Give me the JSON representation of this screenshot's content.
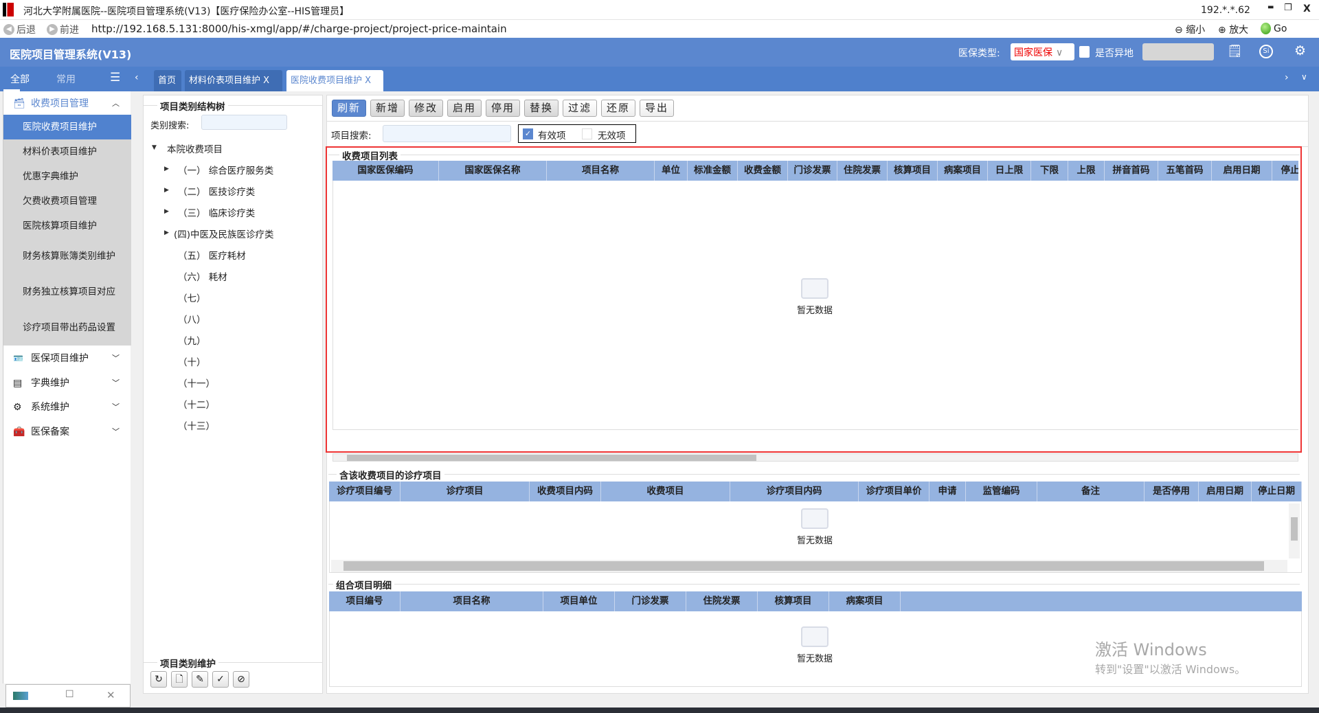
{
  "window": {
    "title": "河北大学附属医院--医院项目管理系统(V13)【医疗保险办公室--HIS管理员】",
    "ip": "192.*.*.62",
    "minimize": "▬",
    "restore": "❐",
    "close": "X"
  },
  "browser": {
    "back": "后退",
    "forward": "前进",
    "url": "http://192.168.5.131:8000/his-xmgl/app/#/charge-project/project-price-maintain",
    "zoom_out": "缩小",
    "zoom_in": "放大",
    "go": "Go"
  },
  "header": {
    "app_title": "医院项目管理系统(V13)",
    "insurance_type_label": "医保类型:",
    "insurance_type_value": "国家医保",
    "remote_label": "是否异地",
    "remote_checked": false,
    "accent": "#5b87cf"
  },
  "sidebar": {
    "tabs": [
      "全部",
      "常用"
    ],
    "active_tab": "全部",
    "groups": [
      {
        "label": "收费项目管理",
        "icon": "cash-register-icon",
        "expanded": true,
        "items": [
          "医院收费项目维护",
          "材料价表项目维护",
          "优惠字典维护",
          "欠费收费项目管理",
          "医院核算项目维护",
          "财务核算账簿类别维护",
          "财务独立核算项目对应",
          "诊疗项目带出药品设置"
        ],
        "active": "医院收费项目维护"
      },
      {
        "label": "医保项目维护",
        "icon": "id-card-icon"
      },
      {
        "label": "字典维护",
        "icon": "list-icon"
      },
      {
        "label": "系统维护",
        "icon": "gear-icon"
      },
      {
        "label": "医保备案",
        "icon": "medical-kit-icon"
      }
    ]
  },
  "tabs": [
    {
      "label": "首页",
      "closable": false
    },
    {
      "label": "材料价表项目维护",
      "closable": true
    },
    {
      "label": "医院收费项目维护",
      "closable": true,
      "active": true
    }
  ],
  "tree": {
    "title": "项目类别结构树",
    "search_label": "类别搜索:",
    "search_value": "",
    "root": "本院收费项目",
    "nodes": [
      {
        "label": "（一） 综合医疗服务类",
        "has_children": true
      },
      {
        "label": "（二） 医技诊疗类",
        "has_children": true
      },
      {
        "label": "（三） 临床诊疗类",
        "has_children": true
      },
      {
        "label": "(四)中医及民族医诊疗类",
        "has_children": true
      },
      {
        "label": "（五） 医疗耗材"
      },
      {
        "label": "（六） 耗材"
      },
      {
        "label": "（七）"
      },
      {
        "label": "（八）"
      },
      {
        "label": "（九）"
      },
      {
        "label": "（十）"
      },
      {
        "label": "（十一）"
      },
      {
        "label": "（十二）"
      },
      {
        "label": "（十三）"
      }
    ],
    "maintain_title": "项目类别维护",
    "maintain_buttons": [
      "refresh-icon",
      "add-file-icon",
      "edit-icon",
      "check-circle-icon",
      "forbid-icon"
    ]
  },
  "toolbar": {
    "buttons": [
      "刷新",
      "新增",
      "修改",
      "启用",
      "停用",
      "替换",
      "过滤",
      "还原",
      "导出"
    ],
    "search_label": "项目搜索:",
    "search_value": "",
    "valid_label": "有效项",
    "valid_checked": true,
    "invalid_label": "无效项",
    "invalid_checked": false
  },
  "charge_list": {
    "title": "收费项目列表",
    "columns": [
      "国家医保编码",
      "国家医保名称",
      "项目名称",
      "单位",
      "标准金额",
      "收费金额",
      "门诊发票",
      "住院发票",
      "核算项目",
      "病案项目",
      "日上限",
      "下限",
      "上限",
      "拼音首码",
      "五笔首码",
      "启用日期",
      "停止日期"
    ],
    "empty": "暂无数据"
  },
  "diag_list": {
    "title": "含该收费项目的诊疗项目",
    "columns": [
      "诊疗项目编号",
      "诊疗项目",
      "收费项目内码",
      "收费项目",
      "诊疗项目内码",
      "诊疗项目单价",
      "申请",
      "监管编码",
      "备注",
      "是否停用",
      "启用日期",
      "停止日期"
    ],
    "empty": "暂无数据"
  },
  "combo_list": {
    "title": "组合项目明细",
    "columns": [
      "项目编号",
      "项目名称",
      "项目单位",
      "门诊发票",
      "住院发票",
      "核算项目",
      "病案项目"
    ],
    "empty": "暂无数据"
  },
  "watermark": {
    "line1": "激活 Windows",
    "line2": "转到\"设置\"以激活 Windows。"
  }
}
